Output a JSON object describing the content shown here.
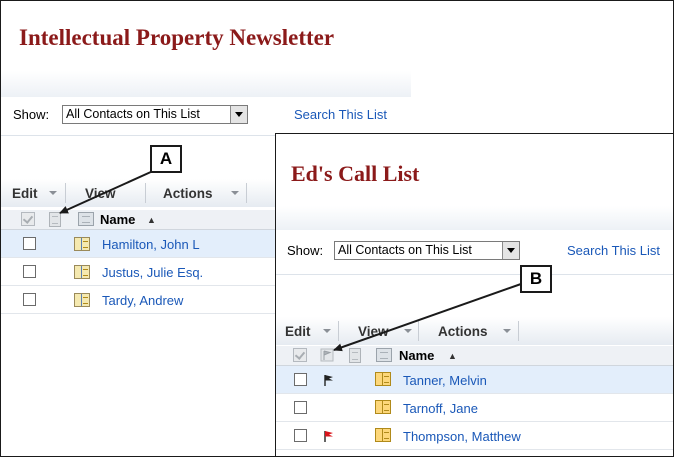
{
  "panel1": {
    "title": "Intellectual Property Newsletter",
    "show_label": "Show:",
    "show_value": "All Contacts on This List",
    "search_link": "Search This List",
    "toolbar": {
      "edit": "Edit",
      "view": "View",
      "actions": "Actions"
    },
    "name_header": "Name",
    "sort_glyph": "▲",
    "rows": [
      {
        "name": "Hamilton, John L"
      },
      {
        "name": "Justus, Julie Esq."
      },
      {
        "name": "Tardy, Andrew"
      }
    ]
  },
  "panel2": {
    "title": "Ed's Call List",
    "show_label": "Show:",
    "show_value": "All Contacts on This List",
    "search_link": "Search This List",
    "toolbar": {
      "edit": "Edit",
      "view": "View",
      "actions": "Actions"
    },
    "name_header": "Name",
    "sort_glyph": "▲",
    "rows": [
      {
        "name": "Tanner, Melvin",
        "flag": "black"
      },
      {
        "name": "Tarnoff, Jane",
        "flag": "none"
      },
      {
        "name": "Thompson, Matthew",
        "flag": "red"
      }
    ]
  },
  "callouts": {
    "a": "A",
    "b": "B"
  },
  "colors": {
    "title": "#8b1a1a",
    "link": "#1a58b8",
    "selected_row": "#e3eefb",
    "flag_black": "#222222",
    "flag_red": "#d8141b"
  }
}
